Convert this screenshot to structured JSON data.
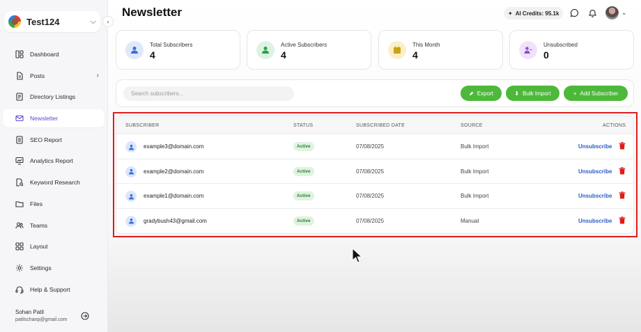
{
  "sidebar": {
    "workspace_name": "Test124",
    "items": [
      {
        "label": "Dashboard",
        "icon": "dashboard-icon"
      },
      {
        "label": "Posts",
        "icon": "posts-icon"
      },
      {
        "label": "Directory Listings",
        "icon": "directory-icon"
      },
      {
        "label": "Newsletter",
        "icon": "mail-icon"
      },
      {
        "label": "SEO Report",
        "icon": "seo-icon"
      },
      {
        "label": "Analytics Report",
        "icon": "analytics-icon"
      },
      {
        "label": "Keyword Research",
        "icon": "keyword-icon"
      },
      {
        "label": "Files",
        "icon": "folder-icon"
      },
      {
        "label": "Teams",
        "icon": "teams-icon"
      },
      {
        "label": "Layout",
        "icon": "layout-icon"
      },
      {
        "label": "Settings",
        "icon": "gear-icon"
      },
      {
        "label": "Help & Support",
        "icon": "headset-icon"
      }
    ],
    "active_item": "Newsletter",
    "user": {
      "name": "Sohan Patil",
      "email": "patilschanp@gmail.com"
    }
  },
  "header": {
    "title": "Newsletter",
    "credits": "AI Credits: 95.1k"
  },
  "stats": [
    {
      "label": "Total Subscribers",
      "value": "4",
      "icon": "user-icon",
      "color": "#3a6fd8",
      "bg": "#dfe8fb"
    },
    {
      "label": "Active Subscribers",
      "value": "4",
      "icon": "user-check-icon",
      "color": "#2e9e45",
      "bg": "#ddf3e2"
    },
    {
      "label": "This Month",
      "value": "4",
      "icon": "calendar-icon",
      "color": "#c9a21a",
      "bg": "#faf0c8"
    },
    {
      "label": "Unsubscribed",
      "value": "0",
      "icon": "user-minus-icon",
      "color": "#8e4fd1",
      "bg": "#efe3fb"
    }
  ],
  "toolbar": {
    "search_placeholder": "Search subscribers...",
    "export_label": "Export",
    "bulk_import_label": "Bulk Import",
    "add_subscriber_label": "Add Subscriber"
  },
  "table": {
    "columns": [
      "SUBSCRIBER",
      "STATUS",
      "SUBSCRIBED DATE",
      "SOURCE",
      "ACTIONS"
    ],
    "rows": [
      {
        "email": "example3@domain.com",
        "status": "Active",
        "date": "07/08/2025",
        "source": "Bulk Import",
        "action": "Unsubscribe"
      },
      {
        "email": "example2@domain.com",
        "status": "Active",
        "date": "07/08/2025",
        "source": "Bulk Import",
        "action": "Unsubscribe"
      },
      {
        "email": "example1@domain.com",
        "status": "Active",
        "date": "07/08/2025",
        "source": "Bulk Import",
        "action": "Unsubscribe"
      },
      {
        "email": "gradybush43@gmail.com",
        "status": "Active",
        "date": "07/08/2025",
        "source": "Manual",
        "action": "Unsubscribe"
      }
    ]
  },
  "colors": {
    "accent_green": "#4db83a",
    "link_blue": "#2c5cc8",
    "delete_red": "#e01b1b",
    "active_nav": "#5b4bd6"
  }
}
